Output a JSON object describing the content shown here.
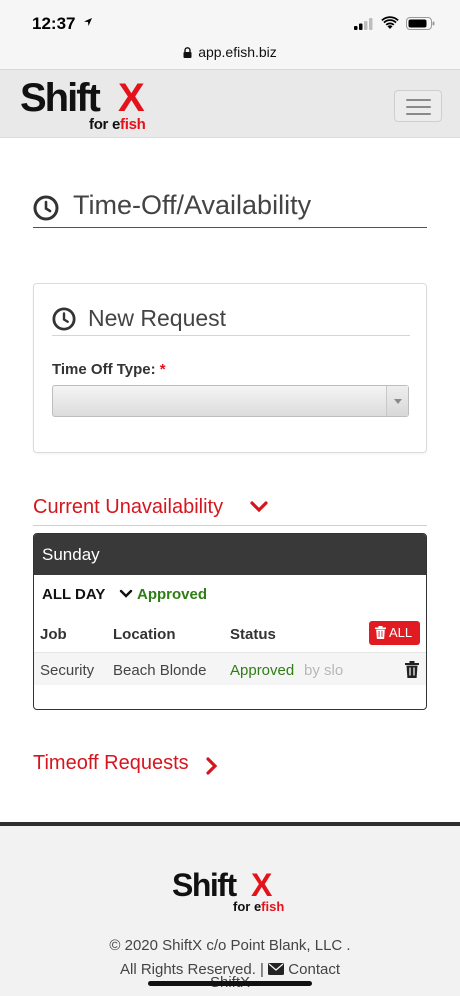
{
  "status_bar": {
    "time": "12:37"
  },
  "browser": {
    "url": "app.efish.biz"
  },
  "brand": {
    "name_main": "Shift",
    "name_accent": "X",
    "tag_prefix": "for e",
    "tag_accent": "fish"
  },
  "page": {
    "title": "Time-Off/Availability"
  },
  "new_request": {
    "title": "New Request",
    "type_label": "Time Off Type:",
    "required_mark": "*",
    "type_value": ""
  },
  "unavailability": {
    "title": "Current Unavailability",
    "day": "Sunday",
    "period": "ALL DAY",
    "period_status": "Approved",
    "columns": {
      "job": "Job",
      "location": "Location",
      "status": "Status"
    },
    "all_button": "ALL",
    "rows": [
      {
        "job": "Security",
        "location": "Beach Blonde",
        "status": "Approved",
        "by": "by slo"
      }
    ]
  },
  "timeoff_link": "Timeoff Requests",
  "footer": {
    "copyright": "© 2020 ShiftX c/o Point Blank, LLC .",
    "rights": "All Rights Reserved. |",
    "contact": "Contact",
    "trailing": "ShiftX"
  },
  "colors": {
    "accent": "#e4131b",
    "approved": "#2f7d16",
    "dark_bar": "#393939"
  }
}
